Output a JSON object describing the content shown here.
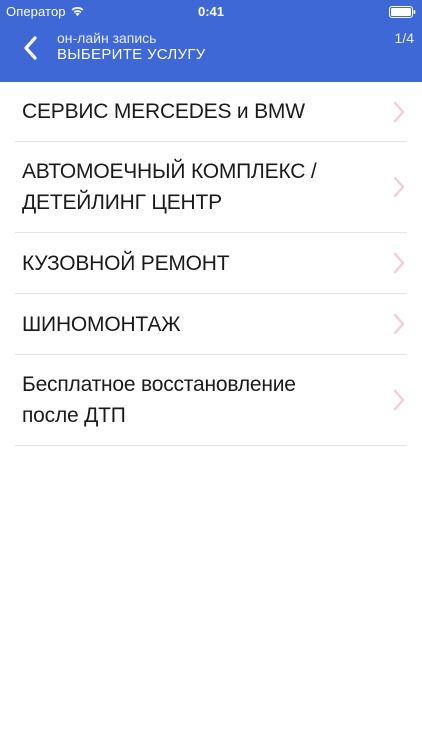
{
  "status_bar": {
    "carrier": "Оператор",
    "time": "0:41"
  },
  "nav": {
    "subtitle": "он-лайн запись",
    "title": "ВЫБЕРИТЕ УСЛУГУ",
    "step": "1/4"
  },
  "services": [
    {
      "line1": "СЕРВИС MERCEDES и BMW",
      "line2": ""
    },
    {
      "line1": "АВТОМОЕЧНЫЙ КОМПЛЕКС /",
      "line2": "ДЕТЕЙЛИНГ ЦЕНТР"
    },
    {
      "line1": "КУЗОВНОЙ РЕМОНТ",
      "line2": ""
    },
    {
      "line1": "ШИНОМОНТАЖ",
      "line2": ""
    },
    {
      "line1": "Бесплатное восстановление",
      "line2": "после ДТП"
    }
  ],
  "colors": {
    "header_bg": "#3f68d7",
    "chevron": "#f2cdd3",
    "separator": "#e6e6e6"
  },
  "icons": {
    "back": "chevron-left-icon",
    "row": "chevron-right-icon",
    "wifi": "wifi-icon",
    "battery": "battery-icon"
  }
}
